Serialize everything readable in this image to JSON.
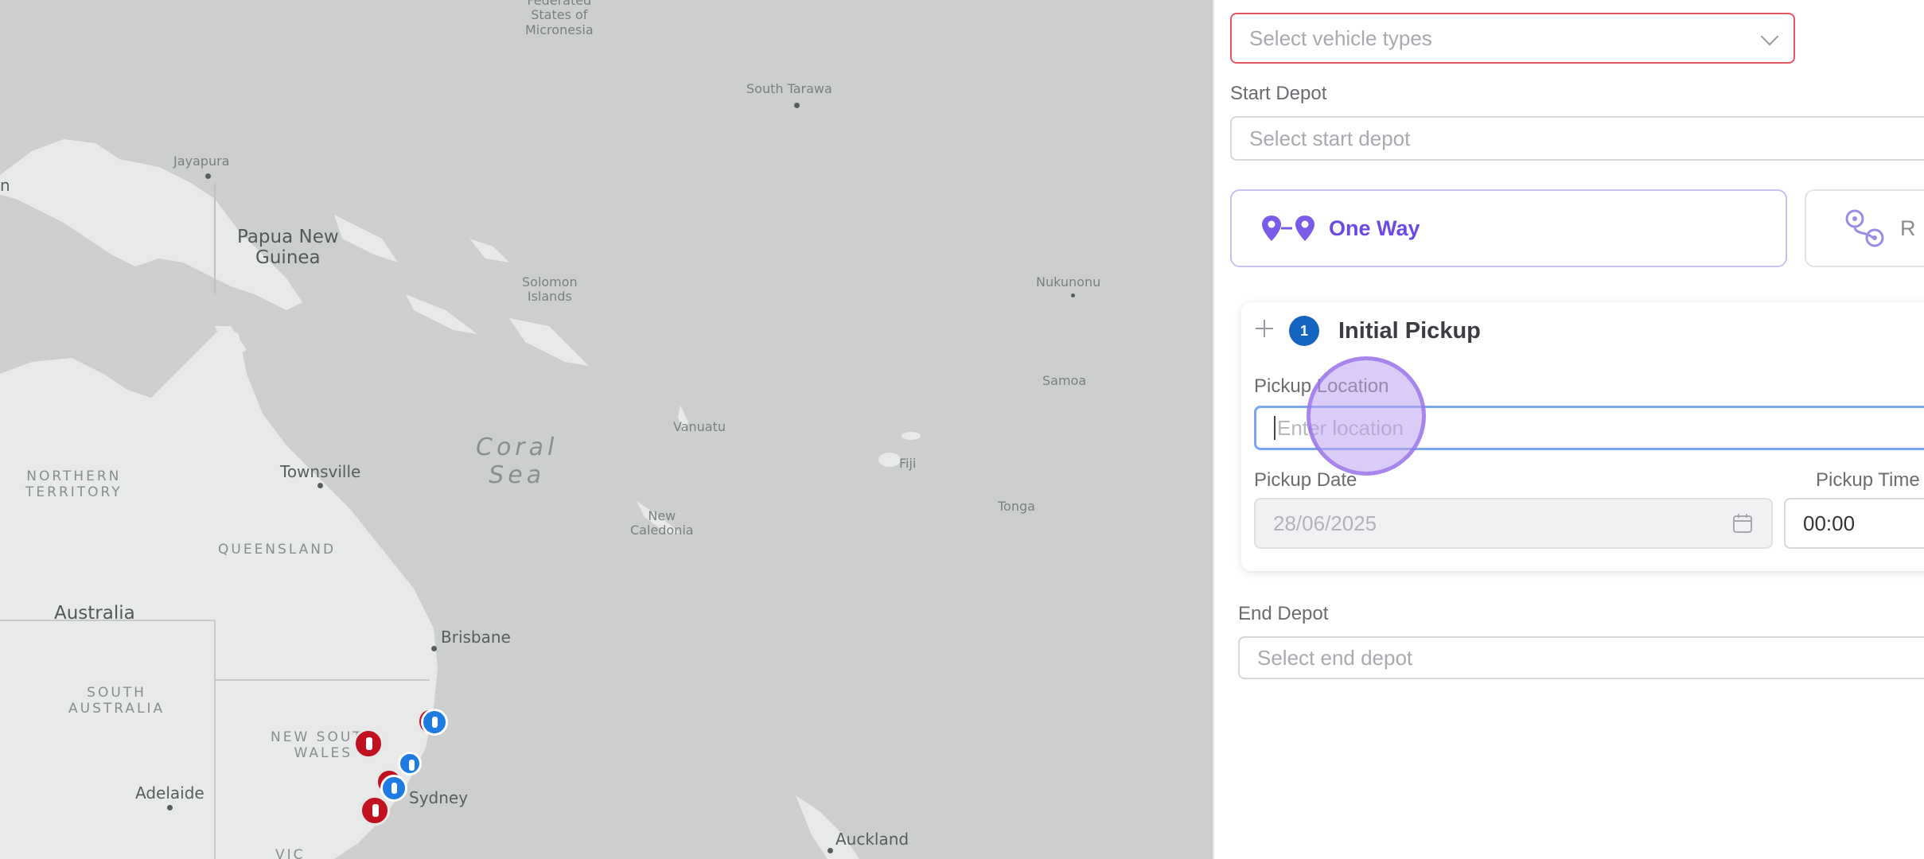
{
  "map": {
    "colors": {
      "water": "#cdcfcf",
      "land": "#e8e9e9",
      "marker_red": "#c1121f",
      "marker_blue": "#1e7be0"
    },
    "labels": {
      "micronesia": "Federated\nStates of\nMicronesia",
      "south_tarawa": "South Tarawa",
      "jayapura": "Jayapura",
      "png": "Papua New\nGuinea",
      "solomon": "Solomon\nIslands",
      "nukunonu": "Nukunonu",
      "samoa": "Samoa",
      "coral_sea": "Coral\nSea",
      "vanuatu": "Vanuatu",
      "fiji": "Fiji",
      "tonga": "Tonga",
      "new_caledonia": "New\nCaledonia",
      "northern_territory": "NORTHERN\nTERRITORY",
      "townsville": "Townsville",
      "queensland": "QUEENSLAND",
      "australia": "Australia",
      "brisbane": "Brisbane",
      "south_australia": "SOUTH\nAUSTRALIA",
      "nsw": "NEW SOUTH\nWALES",
      "sydney": "Sydney",
      "adelaide": "Adelaide",
      "auckland": "Auckland",
      "vic": "VIC",
      "edge_n": "n"
    }
  },
  "panel": {
    "vehicle_types": {
      "placeholder": "Select vehicle types",
      "icon": "chevron-down-icon"
    },
    "start_depot": {
      "label": "Start Depot",
      "placeholder": "Select start depot"
    },
    "trip_type": {
      "one_way": {
        "label": "One Way",
        "icon": "pin-to-pin-icon"
      },
      "round_trip": {
        "label": "R",
        "icon": "round-trip-icon"
      }
    },
    "pickup_card": {
      "step": "1",
      "title": "Initial Pickup",
      "drag_icon": "drag-handle-icon",
      "location_label": "Pickup Location",
      "location_placeholder": "Enter location",
      "date_label": "Pickup Date",
      "date_value": "28/06/2025",
      "date_icon": "calendar-icon",
      "time_label": "Pickup Time",
      "time_value": "00:00"
    },
    "end_depot": {
      "label": "End Depot",
      "placeholder": "Select end depot"
    }
  }
}
